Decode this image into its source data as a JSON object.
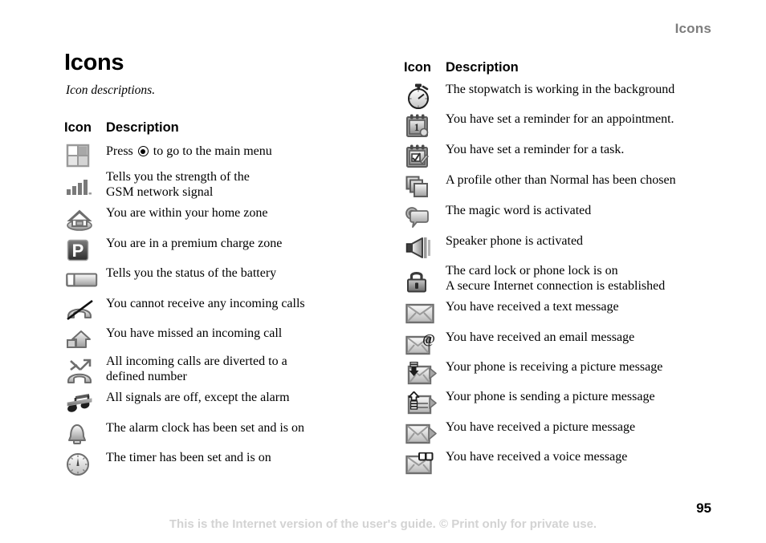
{
  "header": {
    "running_title": "Icons"
  },
  "chapter": {
    "title": "Icons",
    "subtitle": "Icon descriptions."
  },
  "table_head": {
    "icon": "Icon",
    "description": "Description"
  },
  "footer": {
    "note": "This is the Internet version of the user's guide. © Print only for private use.",
    "page_number": "95"
  },
  "colors": {
    "running_header": "#7d7d7d",
    "footer_note": "#d3d3d3",
    "text": "#000000",
    "icon_dark": "#6e6e6e",
    "icon_mid": "#9a9a9a",
    "icon_light": "#d7d7d7"
  },
  "left_column": {
    "rows": [
      {
        "icon": "main-menu-grid-icon",
        "desc_pre": "Press ",
        "desc_post": " to go to the main menu",
        "has_joystick": true
      },
      {
        "icon": "signal-strength-icon",
        "desc": "Tells you the strength of the\nGSM network signal"
      },
      {
        "icon": "home-zone-icon",
        "desc": "You are within your home zone"
      },
      {
        "icon": "premium-charge-zone-icon",
        "desc": "You are in a premium charge zone"
      },
      {
        "icon": "battery-status-icon",
        "desc": "Tells you the status of the battery"
      },
      {
        "icon": "no-incoming-calls-icon",
        "desc": "You cannot receive any incoming calls"
      },
      {
        "icon": "missed-call-icon",
        "desc": "You have missed an incoming call"
      },
      {
        "icon": "call-diverted-icon",
        "desc": "All incoming calls are diverted to a\ndefined number"
      },
      {
        "icon": "silent-except-alarm-icon",
        "desc": "All signals are off, except the alarm"
      },
      {
        "icon": "alarm-clock-icon",
        "desc": "The alarm clock has been set and is on"
      },
      {
        "icon": "timer-icon",
        "desc": "The timer has been set and is on"
      }
    ]
  },
  "right_column": {
    "rows": [
      {
        "icon": "stopwatch-icon",
        "desc": "The stopwatch is working in the background"
      },
      {
        "icon": "appointment-reminder-icon",
        "desc": "You have set a reminder for an appointment."
      },
      {
        "icon": "task-reminder-icon",
        "desc": "You have set a reminder for a task."
      },
      {
        "icon": "profile-icon",
        "desc": "A profile other than Normal has been chosen"
      },
      {
        "icon": "magic-word-icon",
        "desc": "The magic word is activated"
      },
      {
        "icon": "speaker-phone-icon",
        "desc": "Speaker phone is activated"
      },
      {
        "icon": "lock-icon",
        "desc": "The card lock or phone lock is on\nA secure Internet connection is established"
      },
      {
        "icon": "text-message-icon",
        "desc": "You have received a text message"
      },
      {
        "icon": "email-message-icon",
        "desc": "You have received an email message"
      },
      {
        "icon": "receiving-picture-message-icon",
        "desc": "Your phone is receiving a picture message"
      },
      {
        "icon": "sending-picture-message-icon",
        "desc": "Your phone is sending a picture message"
      },
      {
        "icon": "picture-message-icon",
        "desc": "You have received a picture message"
      },
      {
        "icon": "voice-message-icon",
        "desc": "You have received a voice message"
      }
    ]
  }
}
